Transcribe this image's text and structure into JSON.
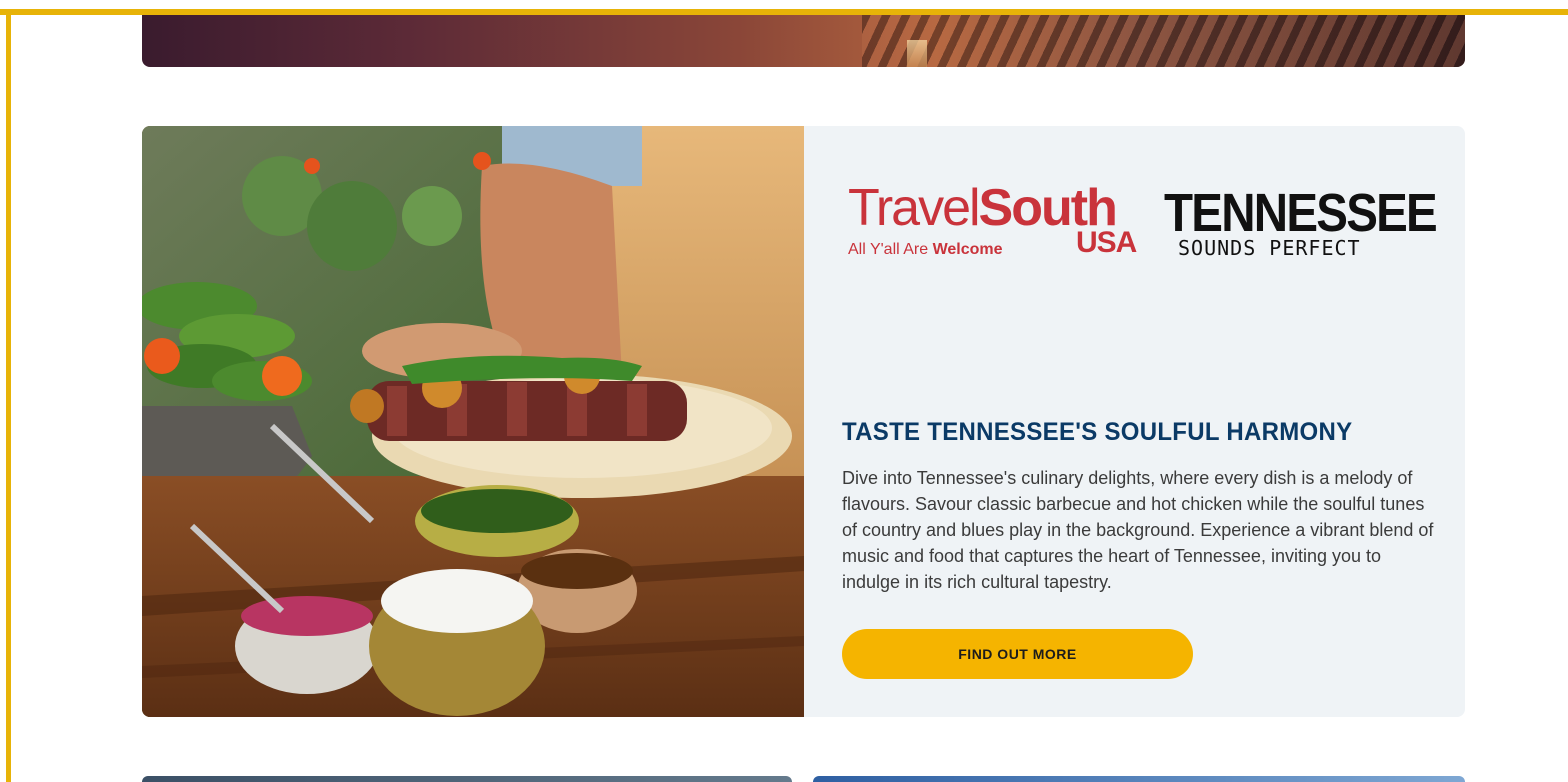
{
  "feature": {
    "logos": {
      "travel_south": {
        "word1": "Travel",
        "word2": "South",
        "tagline_prefix": "All Y'all Are",
        "tagline_bold": "Welcome",
        "country": "USA"
      },
      "tennessee": {
        "word": "TENNESSEE",
        "tagline": "SOUNDS PERFECT"
      }
    },
    "headline": "TASTE TENNESSEE'S SOULFUL HARMONY",
    "body": "Dive into Tennessee's culinary delights, where every dish is a melody of flavours. Savour classic barbecue and hot chicken while the soulful tunes of country and blues play in the background. Experience a vibrant blend of music and food that captures the heart of Tennessee, inviting you to indulge in its rich cultural tapestry.",
    "cta_label": "FIND OUT MORE"
  },
  "colors": {
    "frame": "#e7b308",
    "headline": "#0b3a66",
    "cta_bg": "#f5b400",
    "brand_red": "#c9333b"
  }
}
